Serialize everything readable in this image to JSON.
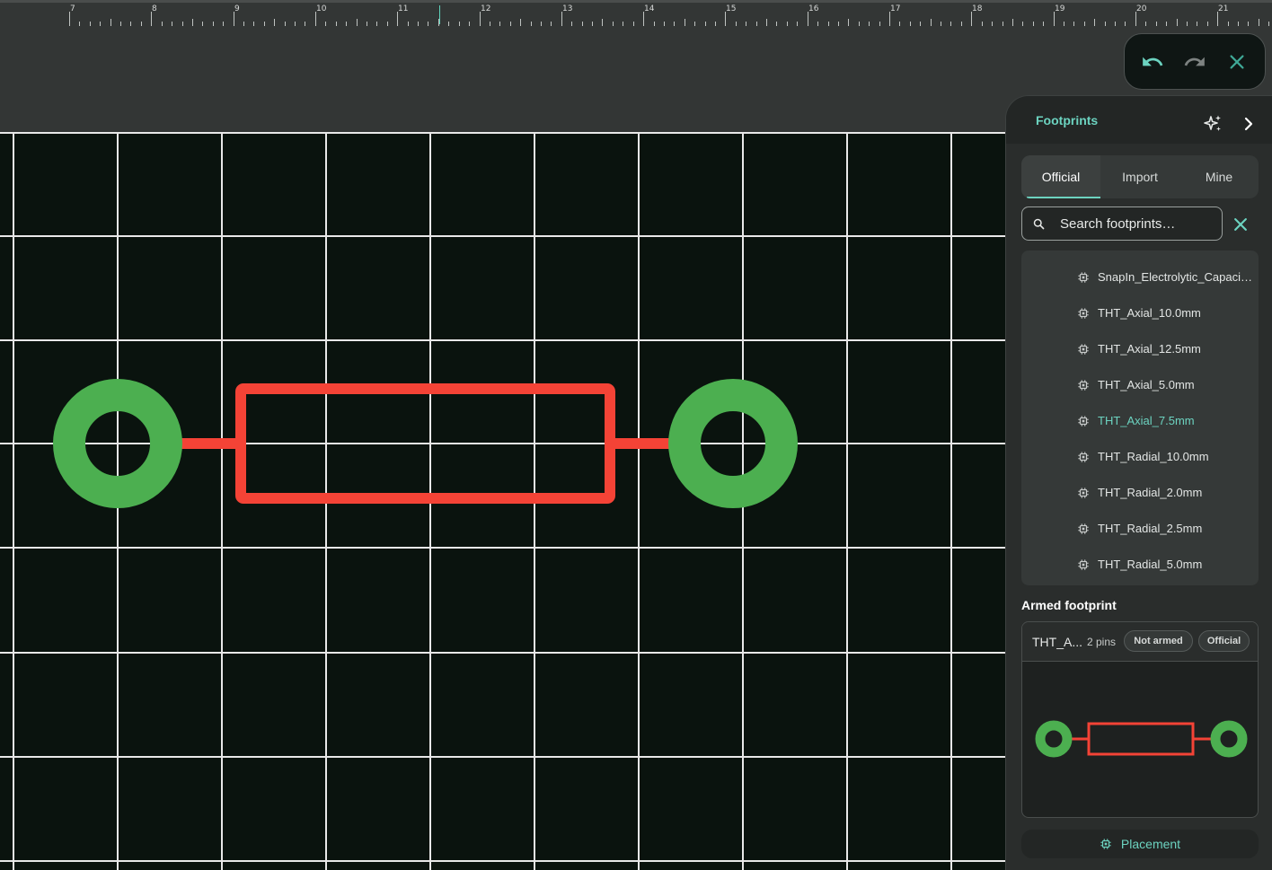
{
  "ruler": {
    "labels": [
      "7",
      "8",
      "9",
      "10",
      "11",
      "12",
      "13",
      "14",
      "15",
      "16",
      "17",
      "18",
      "19",
      "20",
      "21"
    ]
  },
  "toolbar": {
    "undo_icon": "undo-icon",
    "redo_icon": "redo-icon",
    "close_icon": "close-icon"
  },
  "panel": {
    "title": "Footprints",
    "tabs": [
      {
        "label": "Official",
        "active": true
      },
      {
        "label": "Import",
        "active": false
      },
      {
        "label": "Mine",
        "active": false
      }
    ],
    "search": {
      "placeholder": "Search footprints…",
      "value": ""
    },
    "list": {
      "partial_top_label": "–",
      "items": [
        {
          "label": "SnapIn_Electrolytic_Capacitor",
          "selected": false
        },
        {
          "label": "THT_Axial_10.0mm",
          "selected": false
        },
        {
          "label": "THT_Axial_12.5mm",
          "selected": false
        },
        {
          "label": "THT_Axial_5.0mm",
          "selected": false
        },
        {
          "label": "THT_Axial_7.5mm",
          "selected": true
        },
        {
          "label": "THT_Radial_10.0mm",
          "selected": false
        },
        {
          "label": "THT_Radial_2.0mm",
          "selected": false
        },
        {
          "label": "THT_Radial_2.5mm",
          "selected": false
        },
        {
          "label": "THT_Radial_5.0mm",
          "selected": false
        }
      ]
    },
    "armed": {
      "heading": "Armed footprint",
      "name": "THT_A...",
      "pins": "2 pins",
      "status": "Not armed",
      "source": "Official"
    },
    "placement_label": "Placement"
  },
  "colors": {
    "accent": "#6cd3c0",
    "pad": "#4caf50",
    "body": "#f44336",
    "grid": "#e8e8e8",
    "canvas": "#0a130e"
  }
}
